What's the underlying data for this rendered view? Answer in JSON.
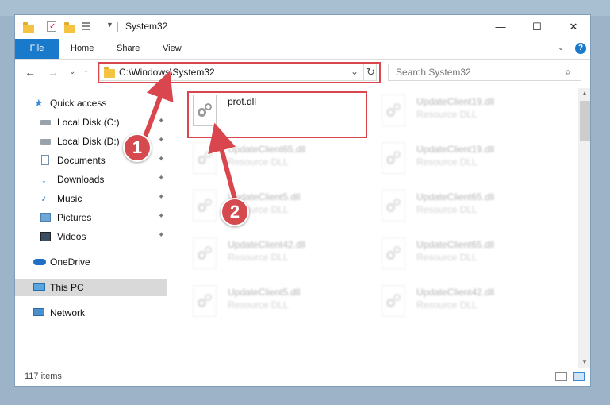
{
  "window": {
    "title": "System32"
  },
  "title_buttons": {
    "minimize": "—",
    "maximize": "☐",
    "close": "✕"
  },
  "ribbon": {
    "tabs": [
      "File",
      "Home",
      "Share",
      "View"
    ]
  },
  "address": {
    "path": "C:\\Windows\\System32",
    "refresh_icon": "↻",
    "dropdown_icon": "⌄"
  },
  "search": {
    "placeholder": "Search System32",
    "icon": "⌕"
  },
  "nav_buttons": {
    "back": "←",
    "forward": "→",
    "recent": "⌄",
    "up": "↑"
  },
  "sidebar": {
    "items": [
      {
        "label": "Quick access",
        "icon": "star-icon"
      },
      {
        "label": "Local Disk (C:)",
        "icon": "drive-icon",
        "pinned": true
      },
      {
        "label": "Local Disk (D:)",
        "icon": "drive-icon",
        "pinned": true
      },
      {
        "label": "Documents",
        "icon": "document-icon",
        "pinned": true
      },
      {
        "label": "Downloads",
        "icon": "download-icon",
        "pinned": true
      },
      {
        "label": "Music",
        "icon": "music-icon",
        "pinned": true
      },
      {
        "label": "Pictures",
        "icon": "picture-icon",
        "pinned": true
      },
      {
        "label": "Videos",
        "icon": "video-icon",
        "pinned": true
      },
      {
        "label": "OneDrive",
        "icon": "cloud-icon"
      },
      {
        "label": "This PC",
        "icon": "computer-icon",
        "selected": true
      },
      {
        "label": "Network",
        "icon": "network-icon"
      }
    ],
    "pin_glyph": "📌"
  },
  "files": {
    "highlighted": {
      "name": "prot.dll"
    },
    "others": [
      {
        "name": "UpdateClient19.dll",
        "type": "Resource DLL"
      },
      {
        "name": "UpdateClient65.dll",
        "type": "Resource DLL"
      },
      {
        "name": "UpdateClient19.dll",
        "type": "Resource DLL"
      },
      {
        "name": "UpdateClient5.dll",
        "type": "Resource DLL"
      },
      {
        "name": "UpdateClient65.dll",
        "type": "Resource DLL"
      },
      {
        "name": "UpdateClient42.dll",
        "type": "Resource DLL"
      },
      {
        "name": "UpdateClient65.dll",
        "type": "Resource DLL"
      },
      {
        "name": "UpdateClient5.dll",
        "type": "Resource DLL"
      },
      {
        "name": "UpdateClient42.dll",
        "type": "Resource DLL"
      }
    ]
  },
  "status": {
    "item_count": "117 items"
  },
  "annotations": {
    "step1": "1",
    "step2": "2",
    "color": "#d9464d"
  }
}
